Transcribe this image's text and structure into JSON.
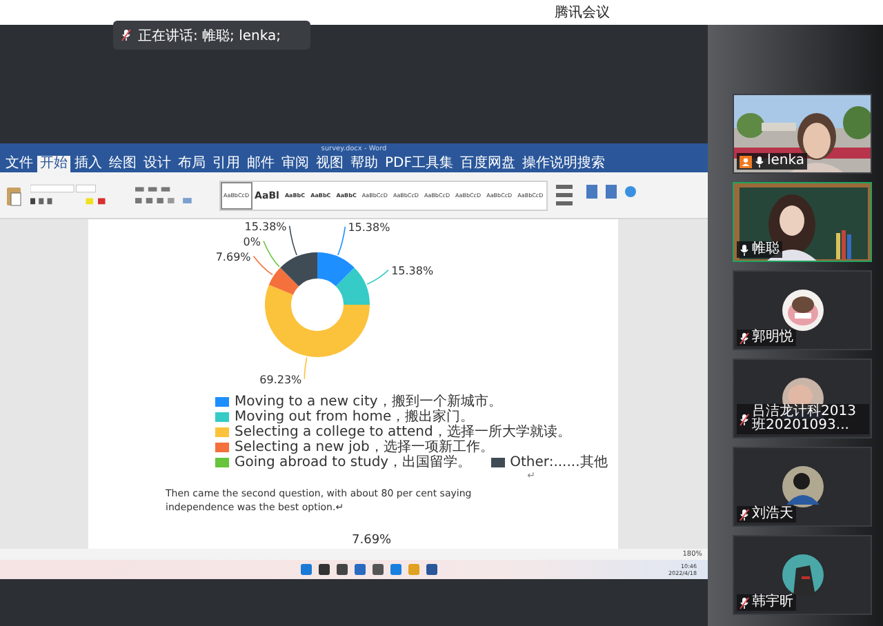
{
  "app_title": "腾讯会议",
  "speaking_toast": {
    "text": "正在讲话: 帷聪; lenka;",
    "muted": true
  },
  "word": {
    "title": "survey.docx - Word",
    "tabs": [
      {
        "label": "文件",
        "selected": false
      },
      {
        "label": "开始",
        "selected": true
      },
      {
        "label": "插入",
        "selected": false
      },
      {
        "label": "绘图",
        "selected": false
      },
      {
        "label": "设计",
        "selected": false
      },
      {
        "label": "布局",
        "selected": false
      },
      {
        "label": "引用",
        "selected": false
      },
      {
        "label": "邮件",
        "selected": false
      },
      {
        "label": "审阅",
        "selected": false
      },
      {
        "label": "视图",
        "selected": false
      },
      {
        "label": "帮助",
        "selected": false
      },
      {
        "label": "PDF工具集",
        "selected": false
      },
      {
        "label": "百度网盘",
        "selected": false
      },
      {
        "label": "操作说明搜索",
        "selected": false
      }
    ],
    "styles": [
      {
        "sample": "AaBbCcD",
        "selected": true
      },
      {
        "sample": "AaBl",
        "selected": false
      },
      {
        "sample": "AaBbC",
        "selected": false
      },
      {
        "sample": "AaBbC",
        "selected": false
      },
      {
        "sample": "AaBbC",
        "selected": false
      },
      {
        "sample": "AaBbCcD",
        "selected": false
      },
      {
        "sample": "AaBbCcD",
        "selected": false
      },
      {
        "sample": "AaBbCcD",
        "selected": false
      },
      {
        "sample": "AaBbCcD",
        "selected": false
      },
      {
        "sample": "AaBbCcD",
        "selected": false
      },
      {
        "sample": "AaBbCcD",
        "selected": false
      }
    ],
    "document": {
      "chart_data": {
        "type": "donut",
        "categories": [
          "Moving to a new city，搬到一个新城市。",
          "Moving out from home，搬出家门。",
          "Selecting a college to attend，选择一所大学就读。",
          "Selecting a new job，选择一项新工作。",
          "Going abroad to study，出国留学。",
          "Other:......其他"
        ],
        "values": [
          15.38,
          15.38,
          69.23,
          7.69,
          0,
          15.38
        ],
        "colors": [
          "#1e8fff",
          "#36cbc6",
          "#fbc23b",
          "#f4703c",
          "#67c43c",
          "#3f4c56"
        ],
        "value_labels": [
          "15.38%",
          "15.38%",
          "69.23%",
          "7.69%",
          "0%",
          "15.38%"
        ]
      },
      "return_mark": "↵",
      "paragraph": "Then came the second question, with about 80 per cent saying independence was the best option.↵",
      "next_chart_label": "7.69%"
    },
    "zoom": "180%",
    "clock": {
      "time": "10:46",
      "date": "2022/4/18"
    }
  },
  "participants": [
    {
      "name": "lenka",
      "kind": "video",
      "host": true,
      "muted": false,
      "speaking": false
    },
    {
      "name": "帷聪",
      "kind": "video",
      "host": false,
      "muted": false,
      "speaking": true
    },
    {
      "name": "郭明悦",
      "kind": "avatar",
      "host": false,
      "muted": true,
      "speaking": false
    },
    {
      "name": "吕洁龙计科2013班20201093...",
      "kind": "avatar",
      "host": false,
      "muted": true,
      "speaking": false
    },
    {
      "name": "刘浩天",
      "kind": "avatar",
      "host": false,
      "muted": true,
      "speaking": false
    },
    {
      "name": "韩宇昕",
      "kind": "avatar",
      "host": false,
      "muted": true,
      "speaking": false
    }
  ]
}
